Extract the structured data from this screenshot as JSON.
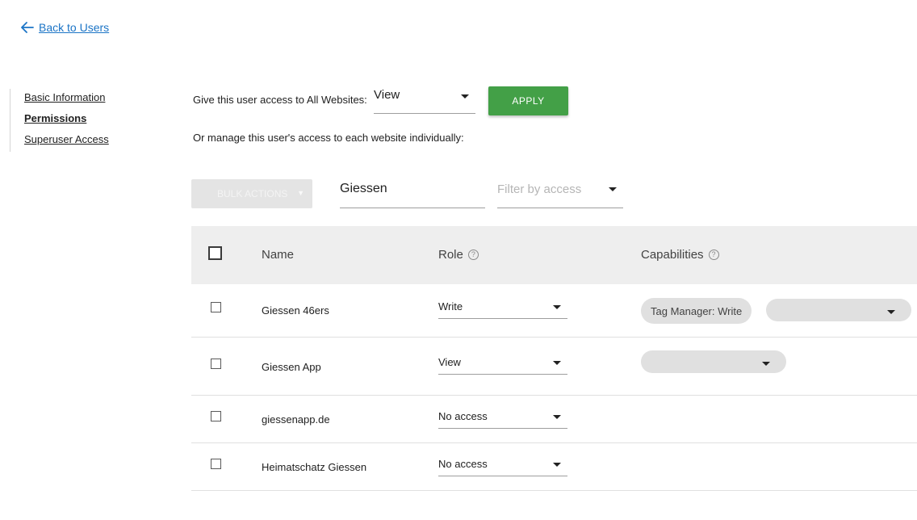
{
  "back_link": {
    "label": "Back to Users",
    "icon": "arrow-left-icon"
  },
  "sidebar": {
    "items": [
      {
        "label": "Basic Information"
      },
      {
        "label": "Permissions"
      },
      {
        "label": "Superuser Access"
      }
    ],
    "active": "Permissions"
  },
  "all_websites": {
    "label": "Give this user access to All Websites:",
    "selected": "View",
    "apply_label": "APPLY"
  },
  "individual_label": "Or manage this user's access to each website individually:",
  "toolbar": {
    "bulk_actions_label": "BULK ACTIONS",
    "search_value": "Giessen",
    "filter_placeholder": "Filter by access"
  },
  "table": {
    "headers": {
      "name": "Name",
      "role": "Role",
      "capabilities": "Capabilities"
    },
    "rows": [
      {
        "name": "Giessen 46ers",
        "role": "Write",
        "capability_chip": "Tag Manager: Write"
      },
      {
        "name": "Giessen App",
        "role": "View"
      },
      {
        "name": "giessenapp.de",
        "role": "No access"
      },
      {
        "name": "Heimatschatz Giessen",
        "role": "No access"
      }
    ]
  },
  "colors": {
    "link": "#1b74c6",
    "apply_button": "#43a047",
    "header_bg": "#eeeeee",
    "chip_bg": "#e0e0e0"
  }
}
